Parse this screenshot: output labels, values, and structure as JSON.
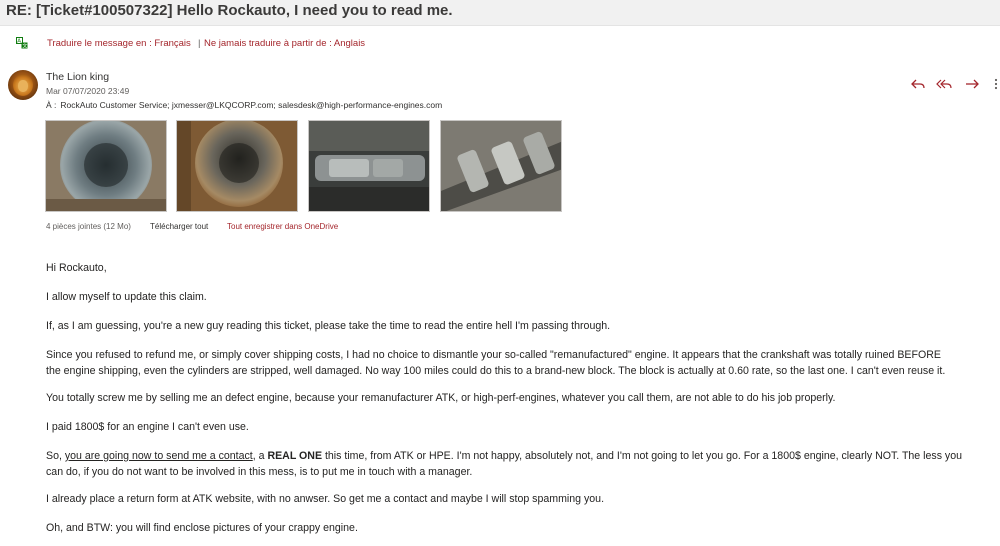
{
  "subject": "RE: [Ticket#100507322] Hello Rockauto, I need you to read me.",
  "translate": {
    "translate_link": "Traduire le message en : Français",
    "separator": "|",
    "never_link": "Ne jamais traduire à partir de : Anglais"
  },
  "sender": {
    "name": "The Lion king",
    "date": "Mar 07/07/2020 23:49",
    "to_label": "À :",
    "recipients": "RockAuto Customer Service; jxmesser@LKQCORP.com; salesdesk@high-performance-engines.com"
  },
  "actions": {
    "reply_icon": "reply-icon",
    "reply_all_icon": "reply-all-icon",
    "forward_icon": "forward-icon",
    "more_icon": "more-icon"
  },
  "attachments": {
    "count_label": "4 pièces jointes (12 Mo)",
    "download_all": "Télécharger tout",
    "save_onedrive": "Tout enregistrer dans OneDrive"
  },
  "body": {
    "greeting": "Hi Rockauto,",
    "p1": "I allow myself to update this claim.",
    "p2": "If, as I am guessing, you're a new guy reading this ticket, please take the time to read the entire hell I'm passing through.",
    "p3a": "Since you refused to refund me, or simply cover shipping costs, I had no choice to dismantle your so-called \"remanufactured\" engine. It appears that the crankshaft was totally ruined BEFORE",
    "p3b": "the engine shipping, even the cylinders are stripped, well damaged. No way 100 miles could do this to a brand-new block. The block is actually at 0.60 rate, so the last one. I can't even reuse it.",
    "p4": "You totally screw me by selling me an defect engine, because your remanufacturer ATK, or high-perf-engines, whatever you call them, are not able to do his job properly.",
    "p5": "I paid 1800$ for an engine I can't even use.",
    "p6_start": "So, ",
    "p6_underlined": "you are going now to send me a contact",
    "p6_mid": ", a ",
    "p6_bold": "REAL ONE",
    "p6_end": " this time, from ATK or HPE. I'm not happy, absolutely not, and I'm not going to let you go. For a 1800$ engine, clearly NOT. The less you",
    "p6b": "can do, if you do not want to be involved in this mess, is to put me in touch with a manager.",
    "p7": "I already place a return form at ATK website, with no anwser. So get me a contact and maybe I will stop spamming you.",
    "p8": "Oh, and BTW: you will find enclose pictures of your crappy engine."
  },
  "colors": {
    "accent": "#a4262c",
    "subject_bar": "#f1f1f1",
    "text": "#252423"
  }
}
